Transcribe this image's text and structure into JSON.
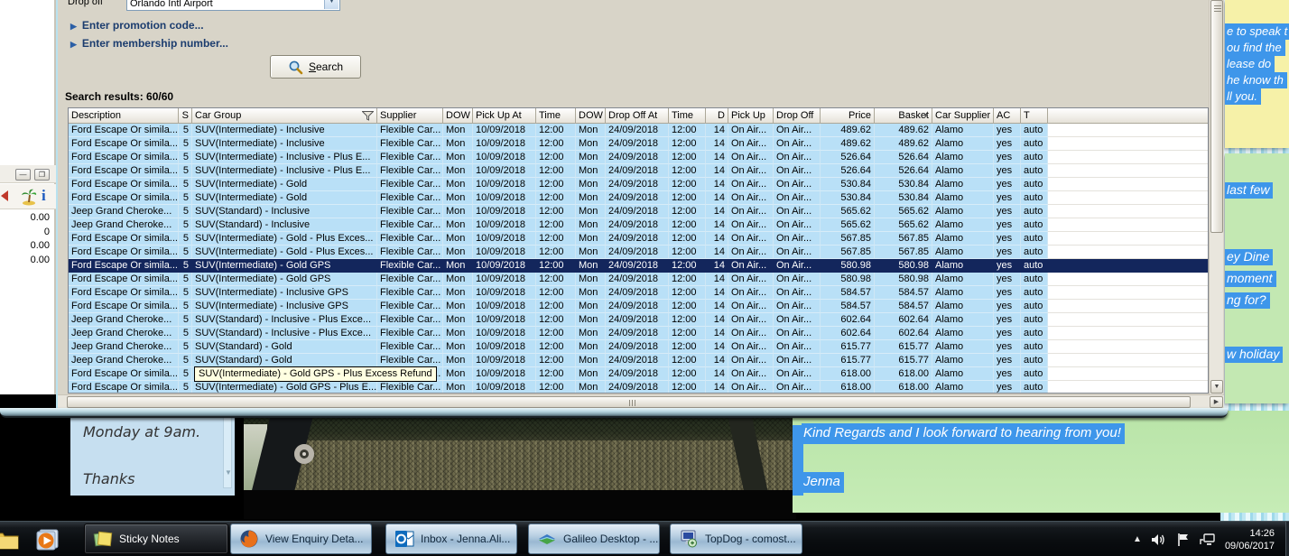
{
  "app": {
    "drop_off_label": "Drop off",
    "drop_off_value": "Orlando Intl Airport",
    "expanders": [
      "Enter promotion code...",
      "Enter membership number..."
    ],
    "search_button": "Search",
    "results_label": "Search results: 60/60",
    "table": {
      "columns": [
        "Description",
        "S",
        "Car Group",
        "Supplier",
        "DOW",
        "Pick Up At",
        "Time",
        "DOW",
        "Drop Off At",
        "Time",
        "D",
        "Pick Up",
        "Drop Off",
        "Price",
        "Basket",
        "Car Supplier",
        "AC",
        "T"
      ],
      "selected_index": 10,
      "tooltip": {
        "row_index": 18,
        "text": "SUV(Intermediate) - Gold GPS - Plus Excess Refund"
      },
      "rows": [
        [
          "Ford Escape Or simila...",
          "5",
          "SUV(Intermediate) - Inclusive",
          "Flexible Car...",
          "Mon",
          "10/09/2018",
          "12:00",
          "Mon",
          "24/09/2018",
          "12:00",
          "14",
          "On Air...",
          "On Air...",
          "489.62",
          "489.62",
          "Alamo",
          "yes",
          "auto"
        ],
        [
          "Ford Escape Or simila...",
          "5",
          "SUV(Intermediate) - Inclusive",
          "Flexible Car...",
          "Mon",
          "10/09/2018",
          "12:00",
          "Mon",
          "24/09/2018",
          "12:00",
          "14",
          "On Air...",
          "On Air...",
          "489.62",
          "489.62",
          "Alamo",
          "yes",
          "auto"
        ],
        [
          "Ford Escape Or simila...",
          "5",
          "SUV(Intermediate) - Inclusive - Plus E...",
          "Flexible Car...",
          "Mon",
          "10/09/2018",
          "12:00",
          "Mon",
          "24/09/2018",
          "12:00",
          "14",
          "On Air...",
          "On Air...",
          "526.64",
          "526.64",
          "Alamo",
          "yes",
          "auto"
        ],
        [
          "Ford Escape Or simila...",
          "5",
          "SUV(Intermediate) - Inclusive - Plus E...",
          "Flexible Car...",
          "Mon",
          "10/09/2018",
          "12:00",
          "Mon",
          "24/09/2018",
          "12:00",
          "14",
          "On Air...",
          "On Air...",
          "526.64",
          "526.64",
          "Alamo",
          "yes",
          "auto"
        ],
        [
          "Ford Escape Or simila...",
          "5",
          "SUV(Intermediate) - Gold",
          "Flexible Car...",
          "Mon",
          "10/09/2018",
          "12:00",
          "Mon",
          "24/09/2018",
          "12:00",
          "14",
          "On Air...",
          "On Air...",
          "530.84",
          "530.84",
          "Alamo",
          "yes",
          "auto"
        ],
        [
          "Ford Escape Or simila...",
          "5",
          "SUV(Intermediate) - Gold",
          "Flexible Car...",
          "Mon",
          "10/09/2018",
          "12:00",
          "Mon",
          "24/09/2018",
          "12:00",
          "14",
          "On Air...",
          "On Air...",
          "530.84",
          "530.84",
          "Alamo",
          "yes",
          "auto"
        ],
        [
          "Jeep Grand Cheroke...",
          "5",
          "SUV(Standard) - Inclusive",
          "Flexible Car...",
          "Mon",
          "10/09/2018",
          "12:00",
          "Mon",
          "24/09/2018",
          "12:00",
          "14",
          "On Air...",
          "On Air...",
          "565.62",
          "565.62",
          "Alamo",
          "yes",
          "auto"
        ],
        [
          "Jeep Grand Cheroke...",
          "5",
          "SUV(Standard) - Inclusive",
          "Flexible Car...",
          "Mon",
          "10/09/2018",
          "12:00",
          "Mon",
          "24/09/2018",
          "12:00",
          "14",
          "On Air...",
          "On Air...",
          "565.62",
          "565.62",
          "Alamo",
          "yes",
          "auto"
        ],
        [
          "Ford Escape Or simila...",
          "5",
          "SUV(Intermediate) - Gold - Plus Exces...",
          "Flexible Car...",
          "Mon",
          "10/09/2018",
          "12:00",
          "Mon",
          "24/09/2018",
          "12:00",
          "14",
          "On Air...",
          "On Air...",
          "567.85",
          "567.85",
          "Alamo",
          "yes",
          "auto"
        ],
        [
          "Ford Escape Or simila...",
          "5",
          "SUV(Intermediate) - Gold - Plus Exces...",
          "Flexible Car...",
          "Mon",
          "10/09/2018",
          "12:00",
          "Mon",
          "24/09/2018",
          "12:00",
          "14",
          "On Air...",
          "On Air...",
          "567.85",
          "567.85",
          "Alamo",
          "yes",
          "auto"
        ],
        [
          "Ford Escape Or simila...",
          "5",
          "SUV(Intermediate) - Gold GPS",
          "Flexible Car...",
          "Mon",
          "10/09/2018",
          "12:00",
          "Mon",
          "24/09/2018",
          "12:00",
          "14",
          "On Air...",
          "On Air...",
          "580.98",
          "580.98",
          "Alamo",
          "yes",
          "auto"
        ],
        [
          "Ford Escape Or simila...",
          "5",
          "SUV(Intermediate) - Gold GPS",
          "Flexible Car...",
          "Mon",
          "10/09/2018",
          "12:00",
          "Mon",
          "24/09/2018",
          "12:00",
          "14",
          "On Air...",
          "On Air...",
          "580.98",
          "580.98",
          "Alamo",
          "yes",
          "auto"
        ],
        [
          "Ford Escape Or simila...",
          "5",
          "SUV(Intermediate) - Inclusive GPS",
          "Flexible Car...",
          "Mon",
          "10/09/2018",
          "12:00",
          "Mon",
          "24/09/2018",
          "12:00",
          "14",
          "On Air...",
          "On Air...",
          "584.57",
          "584.57",
          "Alamo",
          "yes",
          "auto"
        ],
        [
          "Ford Escape Or simila...",
          "5",
          "SUV(Intermediate) - Inclusive GPS",
          "Flexible Car...",
          "Mon",
          "10/09/2018",
          "12:00",
          "Mon",
          "24/09/2018",
          "12:00",
          "14",
          "On Air...",
          "On Air...",
          "584.57",
          "584.57",
          "Alamo",
          "yes",
          "auto"
        ],
        [
          "Jeep Grand Cheroke...",
          "5",
          "SUV(Standard) - Inclusive - Plus Exce...",
          "Flexible Car...",
          "Mon",
          "10/09/2018",
          "12:00",
          "Mon",
          "24/09/2018",
          "12:00",
          "14",
          "On Air...",
          "On Air...",
          "602.64",
          "602.64",
          "Alamo",
          "yes",
          "auto"
        ],
        [
          "Jeep Grand Cheroke...",
          "5",
          "SUV(Standard) - Inclusive - Plus Exce...",
          "Flexible Car...",
          "Mon",
          "10/09/2018",
          "12:00",
          "Mon",
          "24/09/2018",
          "12:00",
          "14",
          "On Air...",
          "On Air...",
          "602.64",
          "602.64",
          "Alamo",
          "yes",
          "auto"
        ],
        [
          "Jeep Grand Cheroke...",
          "5",
          "SUV(Standard) - Gold",
          "Flexible Car...",
          "Mon",
          "10/09/2018",
          "12:00",
          "Mon",
          "24/09/2018",
          "12:00",
          "14",
          "On Air...",
          "On Air...",
          "615.77",
          "615.77",
          "Alamo",
          "yes",
          "auto"
        ],
        [
          "Jeep Grand Cheroke...",
          "5",
          "SUV(Standard) - Gold",
          "Flexible Car...",
          "Mon",
          "10/09/2018",
          "12:00",
          "Mon",
          "24/09/2018",
          "12:00",
          "14",
          "On Air...",
          "On Air...",
          "615.77",
          "615.77",
          "Alamo",
          "yes",
          "auto"
        ],
        [
          "Ford Escape Or simila...",
          "5",
          "SUV(Intermediate) - Gold GPS - Plus E...",
          "Flexible Car...",
          "Mon",
          "10/09/2018",
          "12:00",
          "Mon",
          "24/09/2018",
          "12:00",
          "14",
          "On Air...",
          "On Air...",
          "618.00",
          "618.00",
          "Alamo",
          "yes",
          "auto"
        ],
        [
          "Ford Escape Or simila...",
          "5",
          "SUV(Intermediate) - Gold GPS - Plus E...",
          "Flexible Car...",
          "Mon",
          "10/09/2018",
          "12:00",
          "Mon",
          "24/09/2018",
          "12:00",
          "14",
          "On Air...",
          "On Air...",
          "618.00",
          "618.00",
          "Alamo",
          "yes",
          "auto"
        ]
      ]
    }
  },
  "left_panel": {
    "values": [
      "0.00",
      "0",
      "0.00",
      "0.00"
    ]
  },
  "notes": {
    "yellow": {
      "lines": [
        "e to speak t",
        "ou find the",
        "lease do",
        "he know th",
        "ll you."
      ]
    },
    "green_strip": {
      "lines": [
        "last few",
        "ey Dine",
        "moment",
        "ng for?",
        "w holiday"
      ]
    },
    "blue": {
      "lines": [
        "Monday at 9am.",
        "Thanks"
      ]
    },
    "green_big": {
      "lines": [
        "Kind Regards and I look forward to hearing from you!",
        "Jenna"
      ]
    }
  },
  "taskbar": {
    "buttons": [
      {
        "label": "Sticky Notes",
        "style": "dark",
        "icon": "sticky-notes"
      },
      {
        "label": "View Enquiry Deta...",
        "style": "lit",
        "icon": "firefox"
      },
      {
        "label": "Inbox - Jenna.Ali...",
        "style": "lit",
        "icon": "outlook"
      },
      {
        "label": "Galileo Desktop - ...",
        "style": "lit",
        "icon": "galileo"
      },
      {
        "label": "TopDog - comost...",
        "style": "lit",
        "icon": "topdog"
      }
    ],
    "clock_time": "14:26",
    "clock_date": "09/06/2017"
  },
  "colors": {
    "row_bg": "#b9e0f7",
    "selected_row_bg": "#13265c",
    "selection_highlight": "#3e96ea",
    "note_yellow": "#f6f1a8",
    "note_green": "#c3e8b2",
    "note_blue": "#c6dff0",
    "tooltip_bg": "#ffffe1"
  }
}
